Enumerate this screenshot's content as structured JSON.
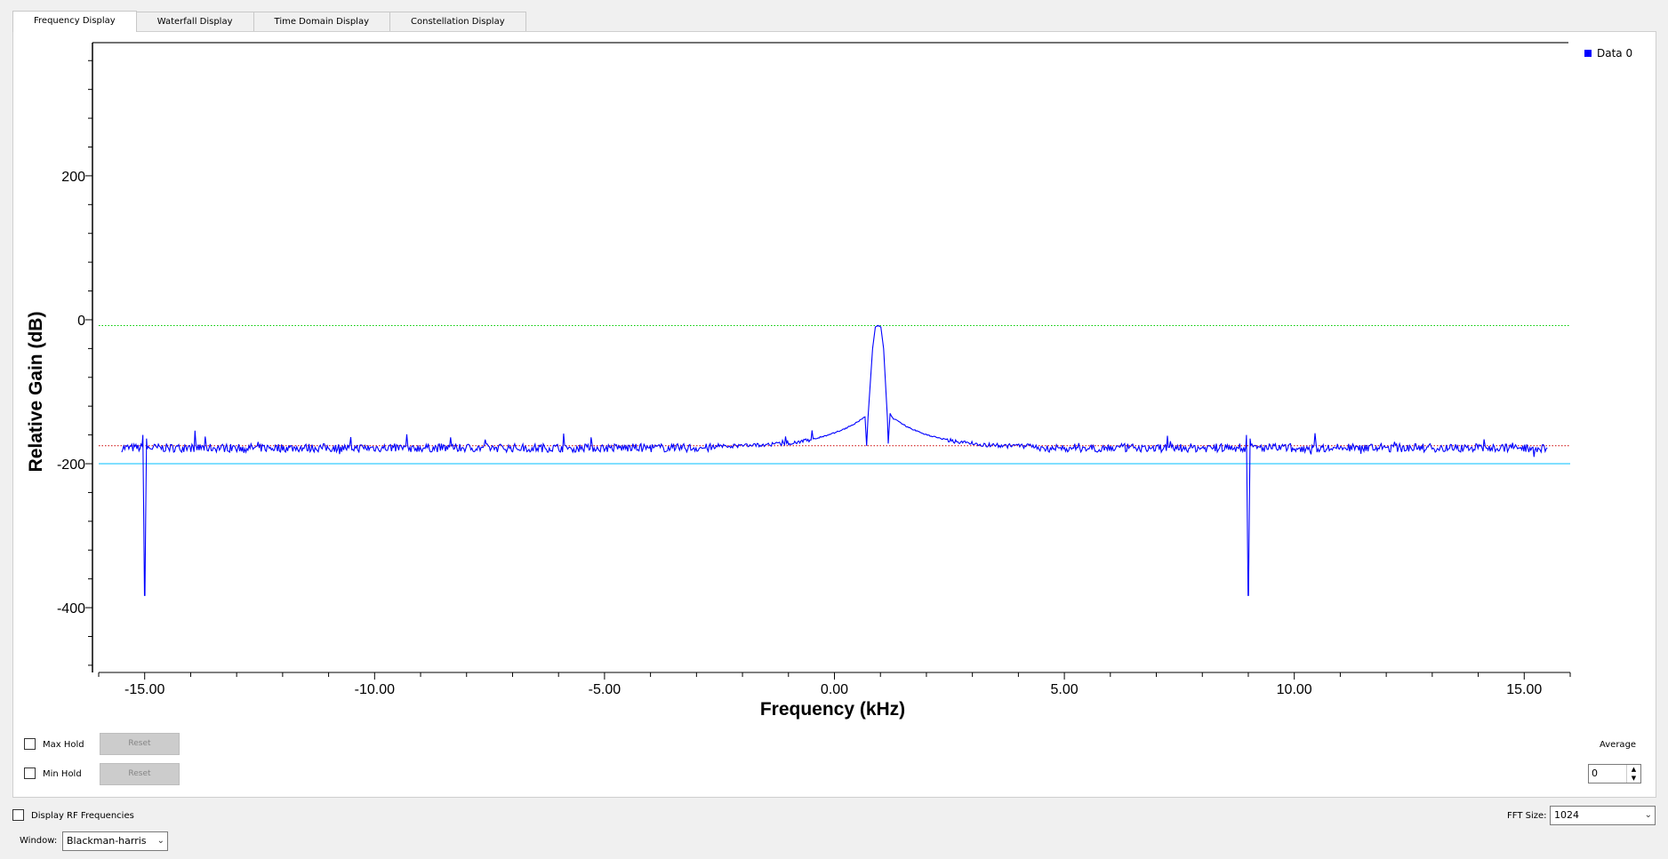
{
  "tabs": [
    "Frequency Display",
    "Waterfall Display",
    "Time Domain Display",
    "Constellation Display"
  ],
  "legend": {
    "label": "Data 0",
    "color": "#0000ff"
  },
  "controls": {
    "max_hold_label": "Max Hold",
    "min_hold_label": "Min Hold",
    "reset_label": "Reset",
    "average_label": "Average",
    "average_value": "0",
    "display_rf_label": "Display RF Frequencies",
    "fft_size_label": "FFT Size:",
    "fft_size_value": "1024",
    "window_label": "Window:",
    "window_value": "Blackman-harris"
  },
  "chart_data": {
    "type": "line",
    "xlabel": "Frequency (kHz)",
    "ylabel": "Relative Gain (dB)",
    "xlim": [
      -16.0,
      16.0
    ],
    "ylim": [
      -490,
      385
    ],
    "x_ticks": [
      "-15.00",
      "-10.00",
      "-5.00",
      "0.00",
      "5.00",
      "10.00",
      "15.00"
    ],
    "y_ticks": [
      "200",
      "0",
      "-200",
      "-400"
    ],
    "series": [
      {
        "name": "Data 0",
        "color": "#0000ff",
        "noise_floor": -178,
        "features": [
          {
            "kind": "main_lobe",
            "x": 0.95,
            "peak": -8
          },
          {
            "kind": "spike_down",
            "x": -15.0,
            "min": -383
          },
          {
            "kind": "spike_down",
            "x": 9.0,
            "min": -383
          }
        ]
      }
    ],
    "reference_lines": [
      {
        "value": -8,
        "color": "#00cc00",
        "style": "dotted"
      },
      {
        "value": -175,
        "color": "#cc0000",
        "style": "dotted"
      },
      {
        "value": -200,
        "color": "#00bfff",
        "style": "solid"
      }
    ],
    "grid": false,
    "legend_position": "top-right"
  }
}
